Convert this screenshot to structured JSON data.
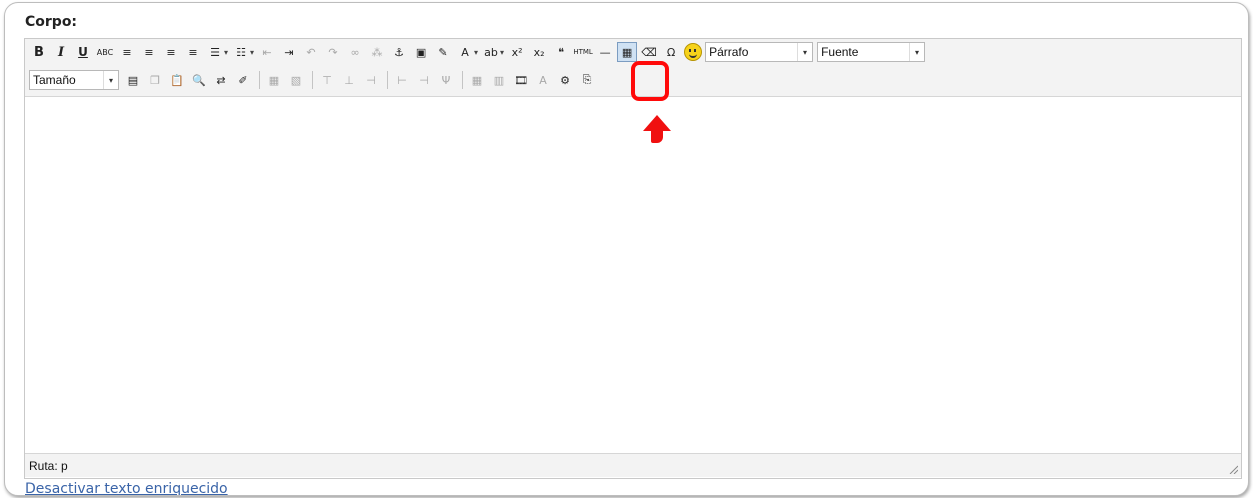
{
  "field_label": "Corpo:",
  "toolbar": {
    "row1": [
      {
        "name": "bold-button",
        "glyph": "B",
        "style": "b"
      },
      {
        "name": "italic-button",
        "glyph": "I",
        "style": "i"
      },
      {
        "name": "underline-button",
        "glyph": "U",
        "style": "u"
      },
      {
        "name": "strikethrough-button",
        "glyph": "ABC",
        "style": "small"
      },
      {
        "name": "align-left-button",
        "glyph": "≡"
      },
      {
        "name": "align-center-button",
        "glyph": "≡"
      },
      {
        "name": "align-right-button",
        "glyph": "≡"
      },
      {
        "name": "align-justify-button",
        "glyph": "≡"
      },
      {
        "name": "bullet-list-button",
        "glyph": "☰"
      },
      {
        "name": "numbered-list-button",
        "glyph": "☷"
      },
      {
        "name": "outdent-button",
        "glyph": "⇤",
        "disabled": true
      },
      {
        "name": "indent-button",
        "glyph": "⇥"
      },
      {
        "name": "undo-button",
        "glyph": "↶",
        "disabled": true
      },
      {
        "name": "redo-button",
        "glyph": "↷",
        "disabled": true
      },
      {
        "name": "link-button",
        "glyph": "∞",
        "disabled": true
      },
      {
        "name": "unlink-button",
        "glyph": "⁂",
        "disabled": true
      },
      {
        "name": "anchor-button",
        "glyph": "⚓"
      },
      {
        "name": "image-button",
        "glyph": "▣"
      },
      {
        "name": "cleanup-button",
        "glyph": "✎"
      },
      {
        "name": "text-color-button",
        "glyph": "A"
      },
      {
        "name": "background-color-button",
        "glyph": "ab"
      },
      {
        "name": "superscript-button",
        "glyph": "x²"
      },
      {
        "name": "subscript-button",
        "glyph": "x₂"
      },
      {
        "name": "blockquote-button",
        "glyph": "❝"
      },
      {
        "name": "html-button",
        "glyph": "HTML"
      },
      {
        "name": "horizontal-rule-button",
        "glyph": "—"
      },
      {
        "name": "visual-aid-button",
        "glyph": "▦",
        "active": true
      },
      {
        "name": "remove-format-button",
        "glyph": "⌫"
      },
      {
        "name": "special-char-button",
        "glyph": "Ω"
      },
      {
        "name": "emoticon-button",
        "glyph": "☺"
      }
    ],
    "format_select": {
      "value": "Párrafo"
    },
    "font_select": {
      "value": "Fuente"
    },
    "size_select": {
      "value": "Tamaño"
    },
    "row2": [
      {
        "name": "table-button",
        "glyph": "▤"
      },
      {
        "name": "copy-button",
        "glyph": "❐",
        "disabled": true
      },
      {
        "name": "paste-word-button",
        "glyph": "📋"
      },
      {
        "name": "find-button",
        "glyph": "🔍"
      },
      {
        "name": "replace-button",
        "glyph": "⇄"
      },
      {
        "name": "edit-button",
        "glyph": "✐"
      },
      {
        "name": "sep"
      },
      {
        "name": "table-props-button",
        "glyph": "▦",
        "disabled": true
      },
      {
        "name": "cell-props-button",
        "glyph": "▧",
        "disabled": true
      },
      {
        "name": "sep"
      },
      {
        "name": "insert-row-before-button",
        "glyph": "⊤",
        "disabled": true
      },
      {
        "name": "insert-row-after-button",
        "glyph": "⊥",
        "disabled": true
      },
      {
        "name": "delete-row-button",
        "glyph": "⊣",
        "disabled": true
      },
      {
        "name": "sep"
      },
      {
        "name": "insert-col-before-button",
        "glyph": "⊢",
        "disabled": true
      },
      {
        "name": "insert-col-after-button",
        "glyph": "⊣",
        "disabled": true
      },
      {
        "name": "delete-col-button",
        "glyph": "Ψ",
        "disabled": true
      },
      {
        "name": "sep"
      },
      {
        "name": "merge-cells-button",
        "glyph": "▦",
        "disabled": true
      },
      {
        "name": "split-cells-button",
        "glyph": "▥",
        "disabled": true
      },
      {
        "name": "media-button",
        "glyph": "🎞"
      },
      {
        "name": "font-style-button",
        "glyph": "A",
        "disabled": true
      },
      {
        "name": "attributes-button",
        "glyph": "⚙"
      },
      {
        "name": "page-break-button",
        "glyph": "⎘"
      }
    ]
  },
  "status": {
    "path_label": "Ruta: p"
  },
  "footer_link": "Desactivar texto enriquecido"
}
